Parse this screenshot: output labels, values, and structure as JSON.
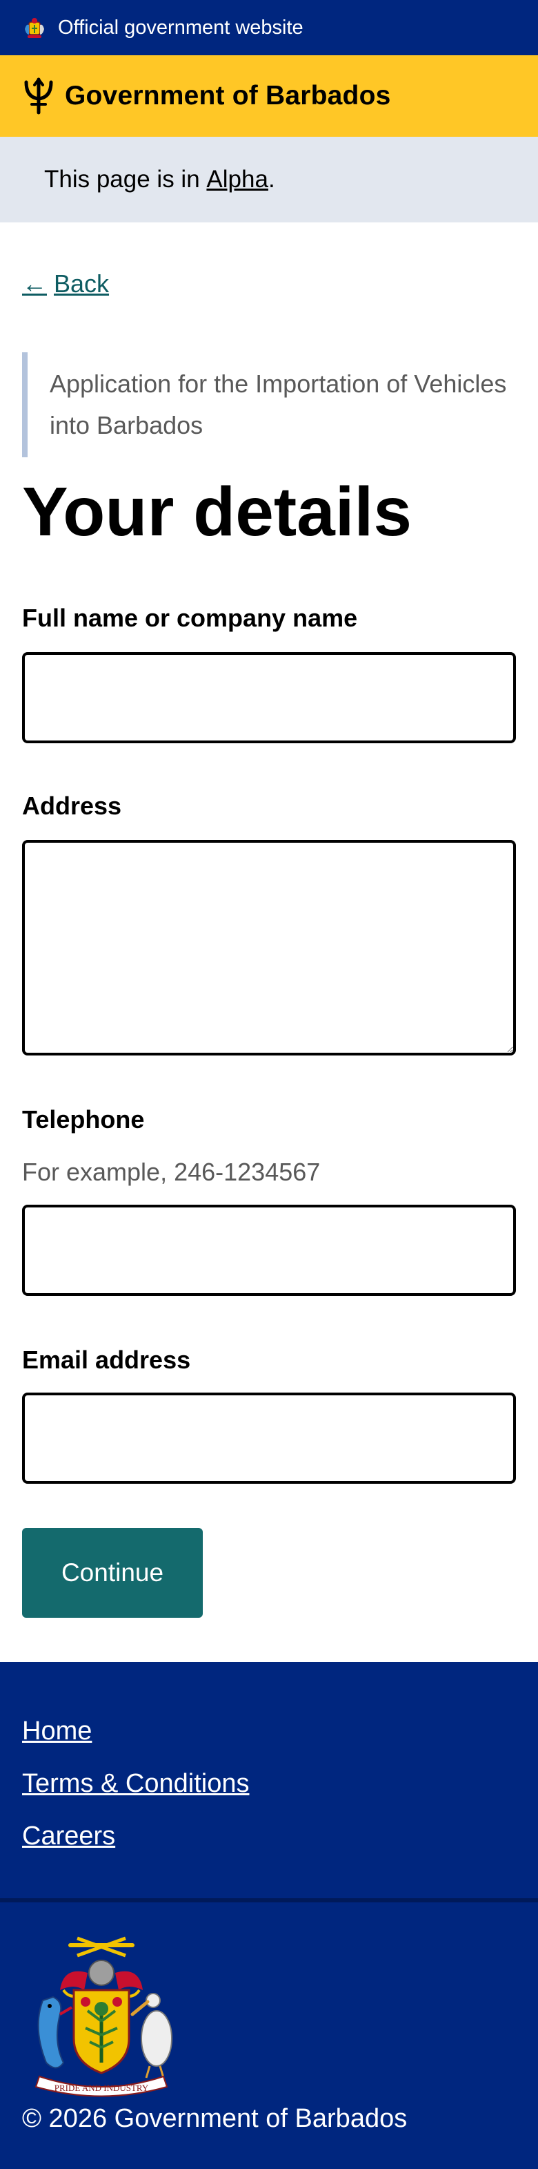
{
  "banner": {
    "official_text": "Official government website",
    "crest_icon": "coat-of-arms-icon",
    "background": "#00267f"
  },
  "header": {
    "title": "Government of Barbados",
    "logo_icon": "trident-icon",
    "background": "#ffc726"
  },
  "phase_banner": {
    "prefix": "This page is in ",
    "phase_link": "Alpha",
    "suffix": "."
  },
  "back_link": {
    "arrow": "←",
    "label": "Back"
  },
  "form": {
    "caption": "Application for the Importation of Vehicles into Barbados",
    "title": "Your details",
    "fields": {
      "name": {
        "label": "Full name or company name",
        "value": ""
      },
      "address": {
        "label": "Address",
        "value": ""
      },
      "telephone": {
        "label": "Telephone",
        "hint": "For example, 246-1234567",
        "value": ""
      },
      "email": {
        "label": "Email address",
        "value": ""
      }
    },
    "continue_label": "Continue",
    "button_color": "#146a6d"
  },
  "footer": {
    "links": [
      "Home",
      "Terms & Conditions",
      "Careers"
    ],
    "copyright": "© 2026 Government of Barbados",
    "coat_of_arms_motto": "PRIDE AND INDUSTRY",
    "background": "#00267f"
  }
}
